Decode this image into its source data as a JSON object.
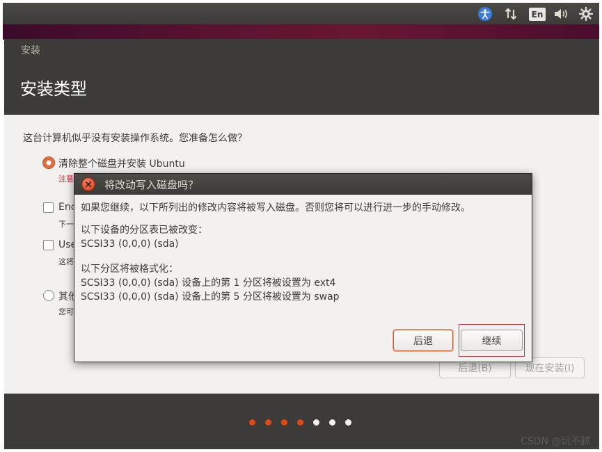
{
  "top_panel": {
    "language_indicator": "En",
    "icons": [
      "accessibility-icon",
      "network-icon",
      "volume-icon",
      "system-gear-icon"
    ]
  },
  "installer": {
    "window_title": "安装",
    "page_title": "安装类型",
    "question": "这台计算机似乎没有安装操作系统。您准备怎么做？",
    "options": [
      {
        "label": "清除整个磁盘并安装 Ubuntu",
        "note": "注意",
        "selected": true
      },
      {
        "label": "Enc",
        "note": "下一",
        "selected": false
      },
      {
        "label": "Use",
        "note": "这将",
        "selected": false
      },
      {
        "label": "其他",
        "note": "您可",
        "selected": false
      }
    ],
    "back_button": "后退(B)",
    "install_now_button": "现在安装(I)",
    "progress": {
      "completed_steps": 4,
      "total_steps": 7,
      "active_color": "#dd4814"
    }
  },
  "dialog": {
    "title": "将改动写入磁盘吗？",
    "intro": "如果您继续，以下所列出的修改内容将被写入磁盘。否则您将可以进行进一步的手动修改。",
    "partition_table_heading": "以下设备的分区表已被改变：",
    "partition_table_device": "SCSI33 (0,0,0) (sda)",
    "format_heading": "以下分区将被格式化：",
    "format_items": [
      "SCSI33 (0,0,0) (sda) 设备上的第 1 分区将被设置为 ext4",
      "SCSI33 (0,0,0) (sda) 设备上的第 5 分区将被设置为 swap"
    ],
    "back_button": "后退",
    "continue_button": "继续"
  },
  "watermark": "CSDN @玩不腻",
  "colors": {
    "panel": "#3c3b37",
    "accent_orange": "#e16b39",
    "warning_red": "#c7162b",
    "highlight_frame": "#cc3333"
  }
}
